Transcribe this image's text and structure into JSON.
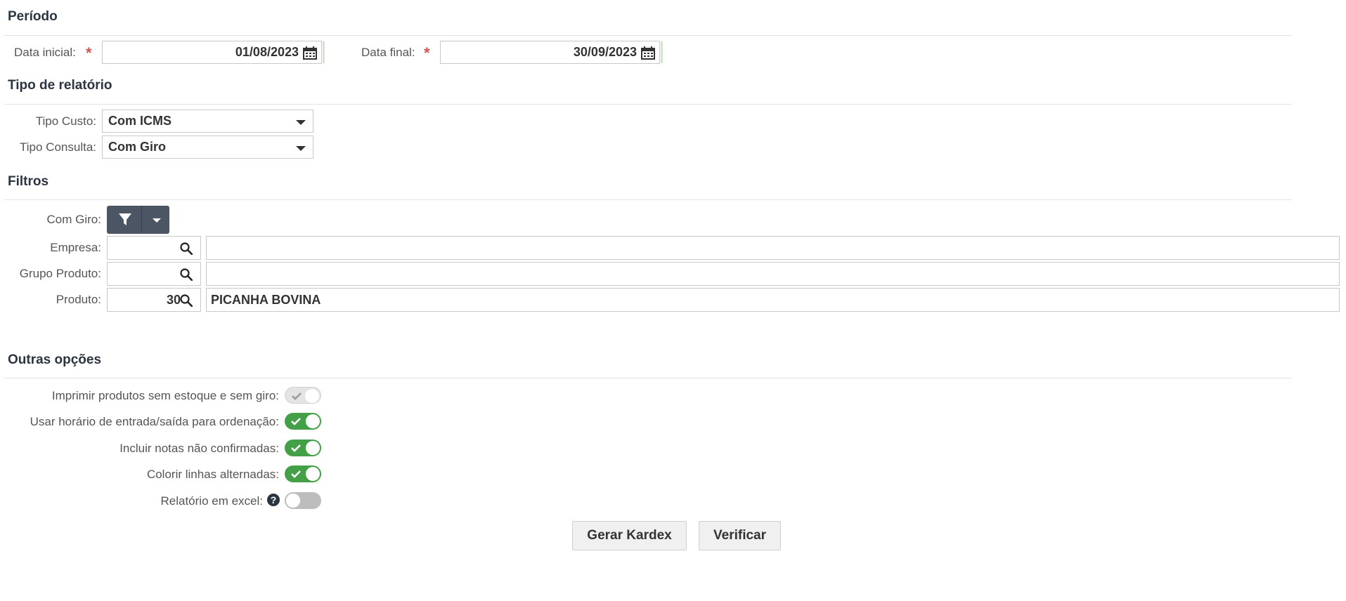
{
  "periodo": {
    "title": "Período",
    "data_inicial_label": "Data inicial:",
    "data_inicial_value": "01/08/2023",
    "data_final_label": "Data final:",
    "data_final_value": "30/09/2023",
    "required_mark": "*"
  },
  "tipo_relatorio": {
    "title": "Tipo de relatório",
    "tipo_custo_label": "Tipo Custo:",
    "tipo_custo_value": "Com ICMS",
    "tipo_consulta_label": "Tipo Consulta:",
    "tipo_consulta_value": "Com Giro"
  },
  "filtros": {
    "title": "Filtros",
    "com_giro_label": "Com Giro:",
    "empresa_label": "Empresa:",
    "empresa_code": "",
    "empresa_desc": "",
    "grupo_label": "Grupo Produto:",
    "grupo_code": "",
    "grupo_desc": "",
    "produto_label": "Produto:",
    "produto_code": "30",
    "produto_desc": "PICANHA BOVINA"
  },
  "outras": {
    "title": "Outras opções",
    "options": [
      {
        "label": "Imprimir produtos sem estoque e sem giro:",
        "state": "disabled-on"
      },
      {
        "label": "Usar horário de entrada/saída para ordenação:",
        "state": "on"
      },
      {
        "label": "Incluir notas não confirmadas:",
        "state": "on"
      },
      {
        "label": "Colorir linhas alternadas:",
        "state": "on"
      },
      {
        "label": "Relatório em excel:",
        "state": "off"
      }
    ],
    "help_glyph": "?"
  },
  "actions": {
    "gerar_label": "Gerar Kardex",
    "verificar_label": "Verificar"
  },
  "colors": {
    "toggle_on": "#43a047",
    "filter_button": "#4b5563",
    "required": "#d9534f"
  }
}
